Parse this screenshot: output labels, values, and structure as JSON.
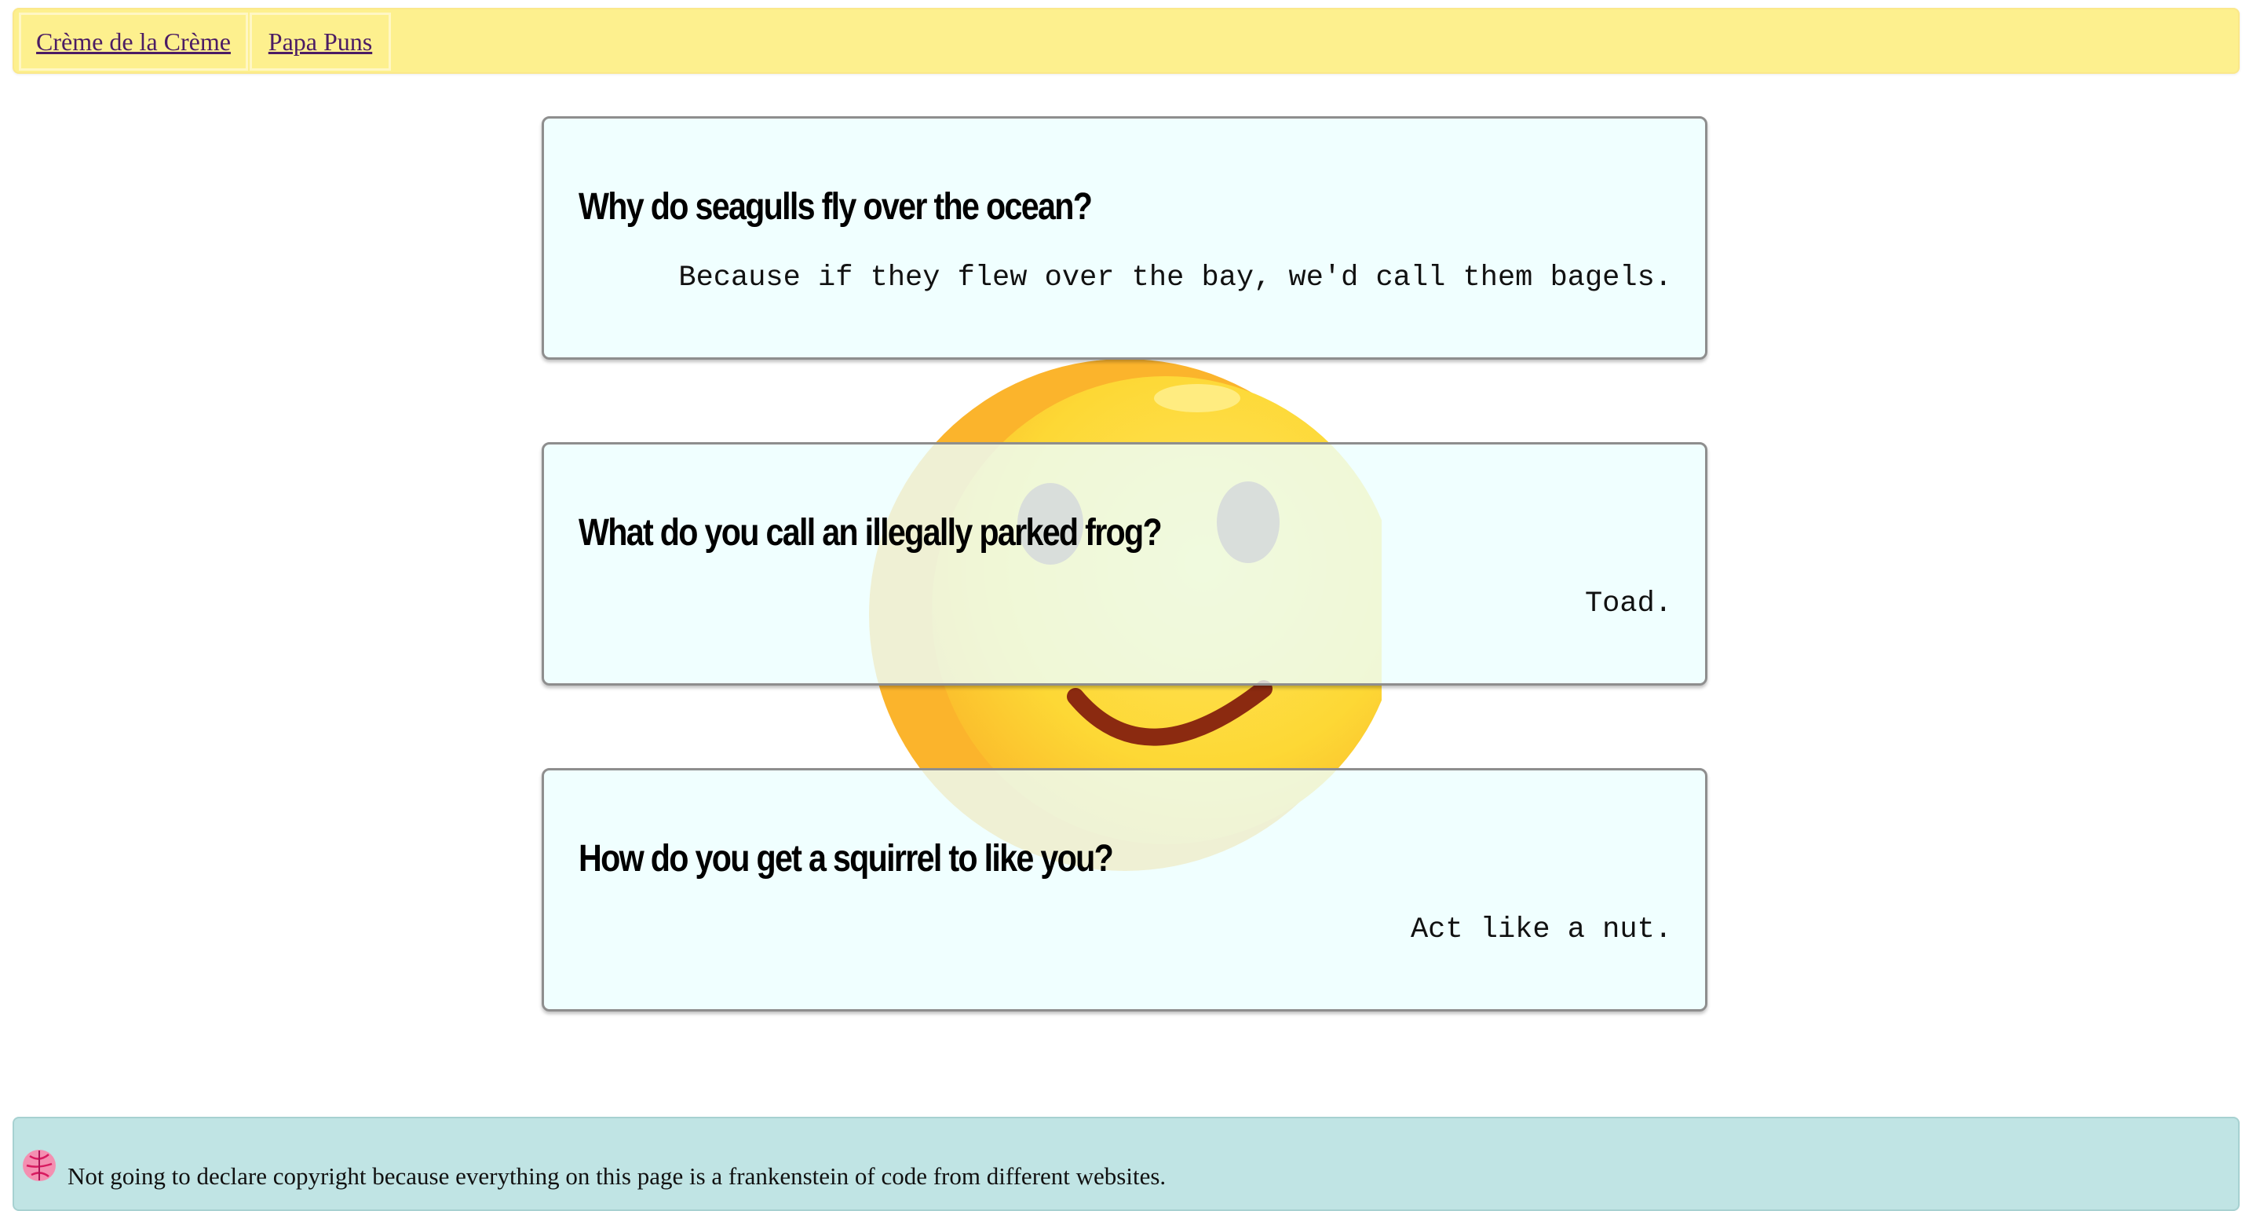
{
  "nav": {
    "items": [
      {
        "label": "Crème de la Crème"
      },
      {
        "label": "Papa Puns"
      }
    ]
  },
  "background": {
    "icon": "smiley-face-icon",
    "colors": {
      "face": "#fdd835",
      "smile": "#8b2a10"
    }
  },
  "jokes": [
    {
      "question": "Why do seagulls fly over the ocean?",
      "answer": "Because if they flew over the bay, we'd call them bagels."
    },
    {
      "question": "What do you call an illegally parked frog?",
      "answer": "Toad."
    },
    {
      "question": "How do you get a squirrel to like you?",
      "answer": "Act like a nut."
    }
  ],
  "footer": {
    "icon": "pink-brain-icon",
    "text": "Not going to declare copyright because everything on this page is a frankenstein of code from different websites."
  },
  "colors": {
    "nav_background": "#fdf08e",
    "card_background": "#ecffff",
    "footer_background": "#c0e4e4",
    "link": "#4b1c64"
  }
}
